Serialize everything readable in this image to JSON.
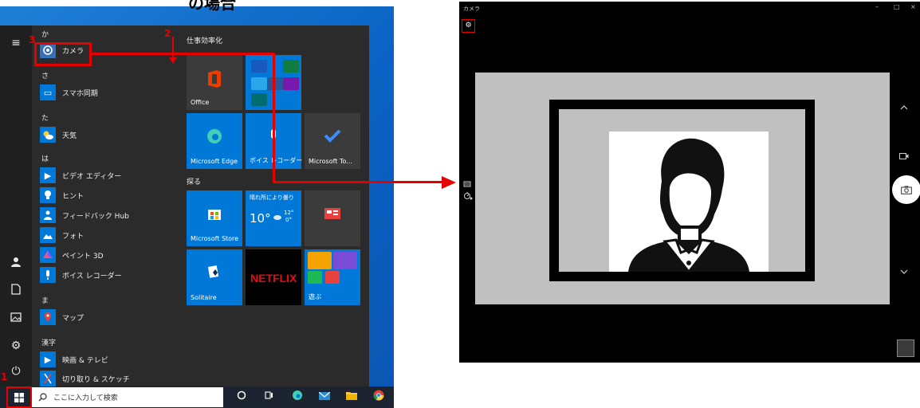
{
  "heading": {
    "text": "の場合"
  },
  "steps": {
    "one": "1",
    "two": "2",
    "three": "3"
  },
  "startmenu": {
    "letters": {
      "ka": "か",
      "sa": "さ",
      "ta": "た",
      "ha": "は",
      "ma": "ま",
      "kanji": "漢字"
    },
    "apps": {
      "camera": "カメラ",
      "phone": "スマホ同期",
      "weather": "天気",
      "video": "ビデオ エディター",
      "tips": "ヒント",
      "feedback": "フィードバック Hub",
      "photos": "フォト",
      "paint3d": "ペイント 3D",
      "recorder": "ボイス レコーダー",
      "maps": "マップ",
      "movies": "映画 & テレビ",
      "snip": "切り取り & スケッチ"
    },
    "groups": {
      "work": "仕事効率化",
      "explore": "探る"
    },
    "tiles": {
      "office": "Office",
      "edge": "Microsoft Edge",
      "voice": "ボイス レコーダー",
      "todo": "Microsoft To...",
      "store": "Microsoft Store",
      "weather_title": "晴れ所により曇り",
      "weather_temp": "10°",
      "weather_high": "12°",
      "weather_low": "0°",
      "netflix": "NETFLIX",
      "solitaire": "Solitaire",
      "play": "遊ぶ"
    }
  },
  "taskbar": {
    "search_placeholder": "ここに入力して検索"
  },
  "camera_app": {
    "title": "カメラ",
    "minimize": "–",
    "maximize": "□",
    "close": "×"
  },
  "colors": {
    "accent_red": "#e60000",
    "desktop_blue": "#0a63c4",
    "tile_blue": "#0078d7",
    "startmenu_bg": "#2b2b2b",
    "camera_bg": "#000000",
    "preview_gray": "#c0c0c0"
  }
}
